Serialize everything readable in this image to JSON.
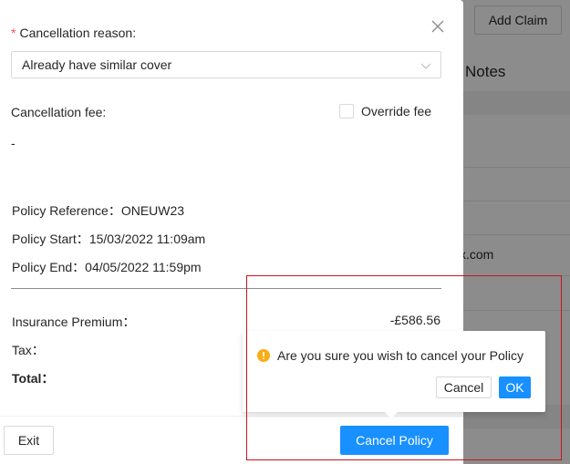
{
  "background": {
    "add_claim_label": "Add Claim",
    "notes_heading": "Notes",
    "partial_email": "x.com"
  },
  "modal": {
    "reason_label": "Cancellation reason:",
    "required_marker": "*",
    "reason_value": "Already have similar cover",
    "fee_label": "Cancellation fee:",
    "override_label": "Override fee",
    "override_checked": false,
    "fee_value": "-",
    "policy_reference_label": "Policy Reference：",
    "policy_reference_value": "ONEUW23",
    "policy_start_label": "Policy Start：",
    "policy_start_value": "15/03/2022 11:09am",
    "policy_end_label": "Policy End：",
    "policy_end_value": "04/05/2022 11:59pm",
    "premium_label": "Insurance Premium：",
    "premium_value": "-£586.56",
    "tax_label": "Tax：",
    "total_label": "Total：",
    "exit_label": "Exit",
    "cancel_policy_label": "Cancel Policy"
  },
  "popconfirm": {
    "message": "Are you sure you wish to cancel your Policy",
    "cancel_label": "Cancel",
    "ok_label": "OK"
  },
  "colors": {
    "primary": "#1890ff",
    "required": "#ff4d4f",
    "warning": "#faad14",
    "highlight": "#c8141e"
  }
}
